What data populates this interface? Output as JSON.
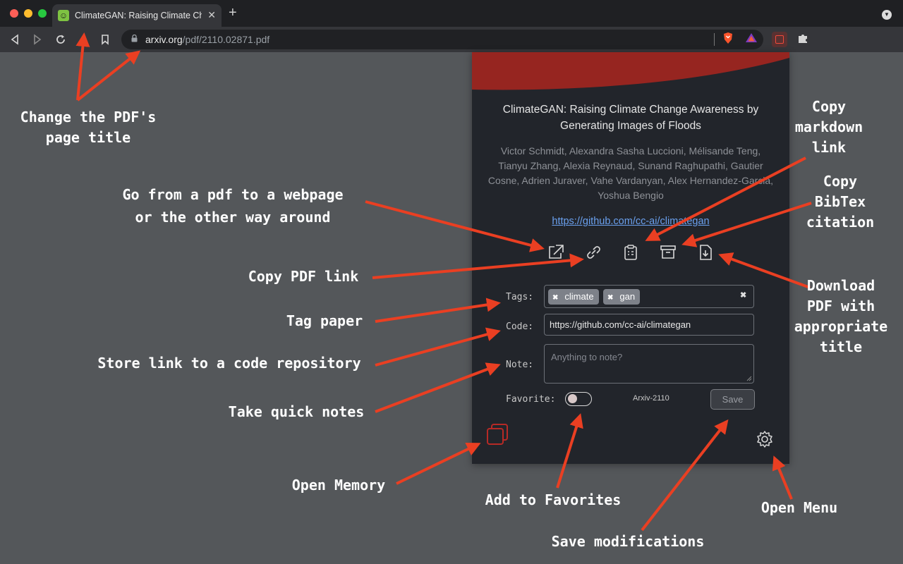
{
  "browser": {
    "tab_title": "ClimateGAN: Raising Climate Change Awareness by Generating Images of Floods",
    "new_tab_symbol": "+",
    "close_symbol": "✕",
    "url_host": "arxiv.org",
    "url_path": "/pdf/2110.02871.pdf",
    "colors": {
      "tabbar": "#1f2023",
      "toolbar": "#35363a",
      "page": "#54575a"
    }
  },
  "popup": {
    "title": "ClimateGAN: Raising Climate Change Awareness by Generating Images of Floods",
    "authors": "Victor Schmidt, Alexandra Sasha Luccioni, Mélisande Teng, Tianyu Zhang, Alexia Reynaud, Sunand Raghupathi, Gautier Cosne, Adrien Juraver, Vahe Vardanyan, Alex Hernandez-Garcia, Yoshua Bengio",
    "code_link": "https://github.com/cc-ai/climategan",
    "tags_label": "Tags:",
    "tags": [
      "climate",
      "gan"
    ],
    "code_label": "Code:",
    "code_value": "https://github.com/cc-ai/climategan",
    "note_label": "Note:",
    "note_placeholder": "Anything to note?",
    "favorite_label": "Favorite:",
    "favorite_on": false,
    "paper_id": "Arxiv-2110",
    "save_label": "Save",
    "icons": [
      "open-webpage-icon",
      "link-icon",
      "clipboard-icon",
      "archive-icon",
      "download-file-icon",
      "memory-cards-icon",
      "gear-icon"
    ],
    "colors": {
      "background": "#22252b",
      "header": "#962520",
      "link": "#6aa0ee"
    }
  },
  "annotations": {
    "change_title": [
      "Change the PDF's",
      "page title"
    ],
    "pdf_webpage": [
      "Go from a pdf to a webpage",
      "or the other way around"
    ],
    "copy_pdf_link": "Copy PDF link",
    "tag_paper": "Tag paper",
    "store_link": "Store link to a code repository",
    "quick_notes": "Take quick notes",
    "open_memory": "Open Memory",
    "add_favorites": "Add to Favorites",
    "save_modifications": "Save modifications",
    "open_menu": "Open Menu",
    "copy_markdown": [
      "Copy",
      "markdown",
      "link"
    ],
    "copy_bibtex": [
      "Copy",
      "BibTex",
      "citation"
    ],
    "download_pdf": [
      "Download",
      "PDF with",
      "appropriate",
      "title"
    ],
    "arrow_color": "#ea3f22"
  }
}
